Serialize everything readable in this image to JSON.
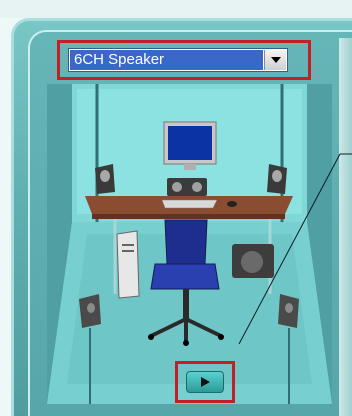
{
  "speaker_config": {
    "selected": "6CH Speaker"
  },
  "icons": {
    "dropdown": "chevron-down-icon",
    "play": "play-icon"
  },
  "colors": {
    "highlight_border": "#c21f27",
    "select_fill": "#3968c9",
    "panel": "#5fb0b2"
  }
}
